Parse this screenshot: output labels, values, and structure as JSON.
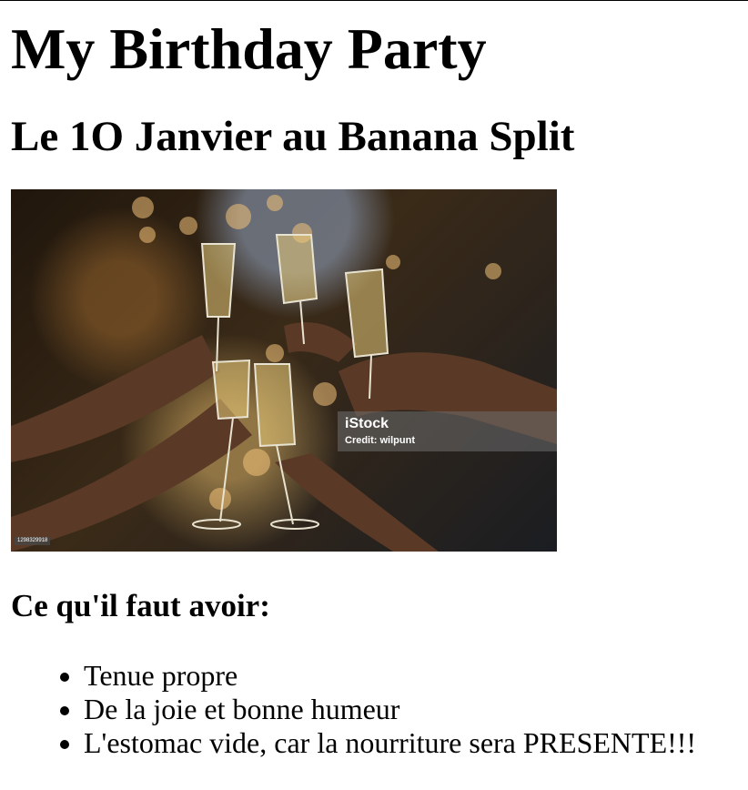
{
  "page": {
    "title": "My Birthday Party",
    "subtitle": "Le 1O Janvier au Banana Split",
    "requirements_heading": "Ce qu'il faut avoir:",
    "requirements": [
      "Tenue propre",
      "De la joie et bonne humeur",
      "L'estomac vide, car la nourriture sera PRESENTE!!!"
    ]
  },
  "photo": {
    "watermark_brand": "iStock",
    "watermark_credit": "Credit: wilpunt",
    "photo_id": "1298329918"
  }
}
